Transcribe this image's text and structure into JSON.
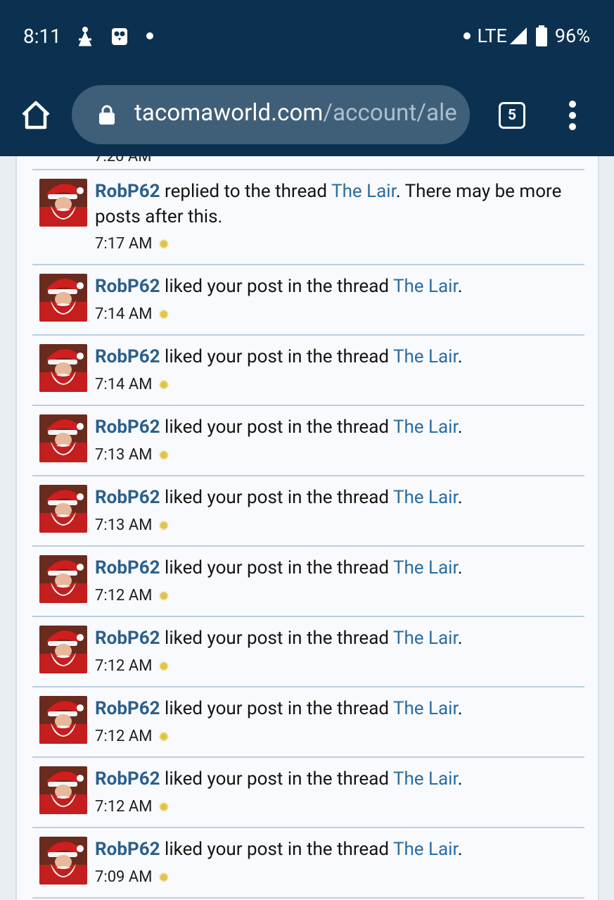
{
  "status_bar": {
    "time": "8:11",
    "network": "LTE",
    "battery": "96%"
  },
  "browser": {
    "url_domain": "tacomaworld.com",
    "url_path": "/account/ale",
    "tab_count": "5"
  },
  "alerts": [
    {
      "user": "RobP62",
      "action": "replied to the thread",
      "thread": "The Lair",
      "suffix": ". There may be more posts after this.",
      "time": "7:17 AM"
    },
    {
      "user": "RobP62",
      "action": "liked your post in the thread",
      "thread": "The Lair",
      "suffix": ".",
      "time": "7:14 AM"
    },
    {
      "user": "RobP62",
      "action": "liked your post in the thread",
      "thread": "The Lair",
      "suffix": ".",
      "time": "7:14 AM"
    },
    {
      "user": "RobP62",
      "action": "liked your post in the thread",
      "thread": "The Lair",
      "suffix": ".",
      "time": "7:13 AM"
    },
    {
      "user": "RobP62",
      "action": "liked your post in the thread",
      "thread": "The Lair",
      "suffix": ".",
      "time": "7:13 AM"
    },
    {
      "user": "RobP62",
      "action": "liked your post in the thread",
      "thread": "The Lair",
      "suffix": ".",
      "time": "7:12 AM"
    },
    {
      "user": "RobP62",
      "action": "liked your post in the thread",
      "thread": "The Lair",
      "suffix": ".",
      "time": "7:12 AM"
    },
    {
      "user": "RobP62",
      "action": "liked your post in the thread",
      "thread": "The Lair",
      "suffix": ".",
      "time": "7:12 AM"
    },
    {
      "user": "RobP62",
      "action": "liked your post in the thread",
      "thread": "The Lair",
      "suffix": ".",
      "time": "7:12 AM"
    },
    {
      "user": "RobP62",
      "action": "liked your post in the thread",
      "thread": "The Lair",
      "suffix": ".",
      "time": "7:09 AM"
    }
  ],
  "colors": {
    "header_bg": "#0c3150",
    "link_user": "#2a5f8c",
    "link_thread": "#2a6da3",
    "unread_star": "#e3c441"
  }
}
